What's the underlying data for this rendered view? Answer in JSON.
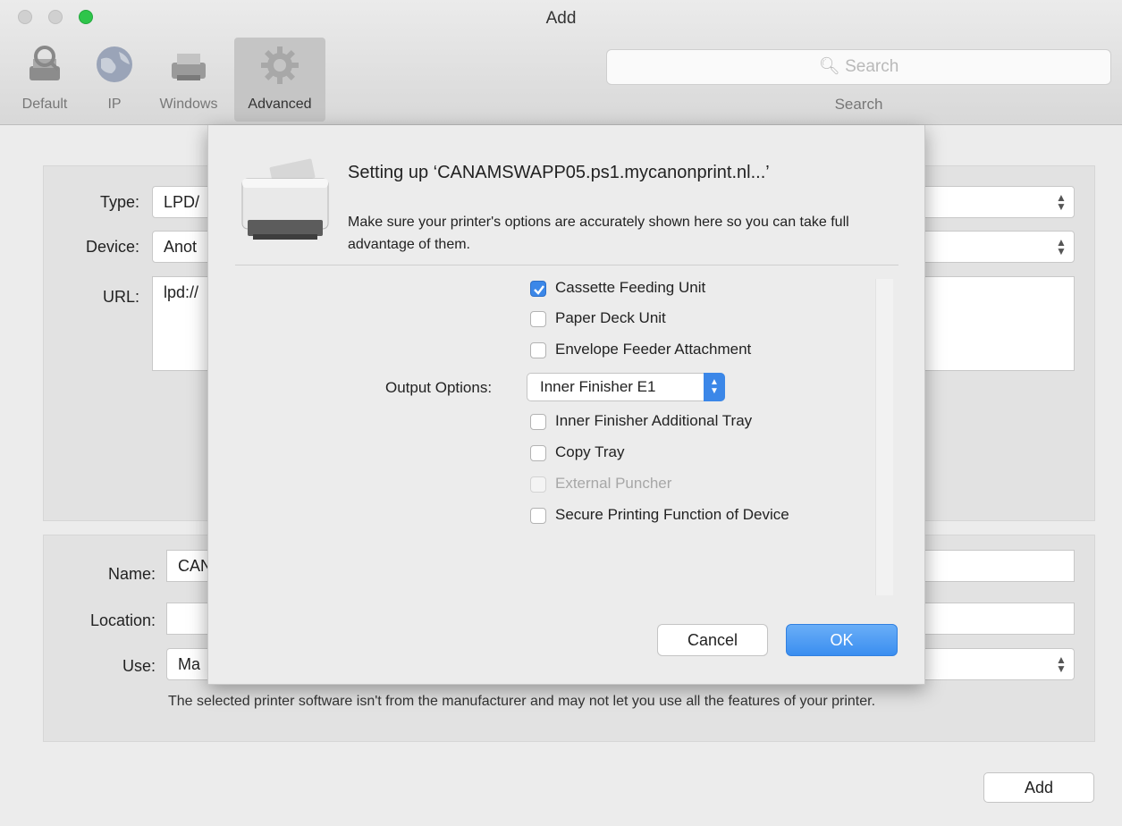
{
  "window": {
    "title": "Add"
  },
  "toolbar": {
    "items": [
      {
        "label": "Default",
        "icon": "default-printer-icon",
        "active": false
      },
      {
        "label": "IP",
        "icon": "globe-icon",
        "active": false
      },
      {
        "label": "Windows",
        "icon": "windows-printer-icon",
        "active": false
      },
      {
        "label": "Advanced",
        "icon": "gear-icon",
        "active": true
      }
    ],
    "search": {
      "placeholder": "Search",
      "label": "Search"
    }
  },
  "form": {
    "type": {
      "label": "Type:",
      "value": "LPD/"
    },
    "device": {
      "label": "Device:",
      "value": "Anot"
    },
    "url": {
      "label": "URL:",
      "value": "lpd://"
    },
    "name": {
      "label": "Name:",
      "value": "CAN"
    },
    "location": {
      "label": "Location:",
      "value": ""
    },
    "use": {
      "label": "Use:",
      "value": "Ma"
    },
    "help_text": "The selected printer software isn't from the manufacturer and may not let you use all the features of your printer.",
    "add_label": "Add"
  },
  "sheet": {
    "title": "Setting up ‘CANAMSWAPP05.ps1.mycanonprint.nl...’",
    "message": "Make sure your printer's options are accurately shown here so you can take full advantage of them.",
    "options_top": [
      {
        "label": "Cassette Feeding Unit",
        "checked": true,
        "disabled": false
      },
      {
        "label": "Paper Deck Unit",
        "checked": false,
        "disabled": false
      },
      {
        "label": "Envelope Feeder Attachment",
        "checked": false,
        "disabled": false
      }
    ],
    "output": {
      "label": "Output Options:",
      "value": "Inner Finisher E1"
    },
    "options_bottom": [
      {
        "label": "Inner Finisher Additional Tray",
        "checked": false,
        "disabled": false
      },
      {
        "label": "Copy Tray",
        "checked": false,
        "disabled": false
      },
      {
        "label": "External Puncher",
        "checked": false,
        "disabled": true
      },
      {
        "label": "Secure Printing Function of Device",
        "checked": false,
        "disabled": false
      }
    ],
    "cancel_label": "Cancel",
    "ok_label": "OK"
  },
  "colors": {
    "accent": "#3b87e8",
    "close_button": "#d0d0d0",
    "zoom_button": "#2ec54a"
  }
}
